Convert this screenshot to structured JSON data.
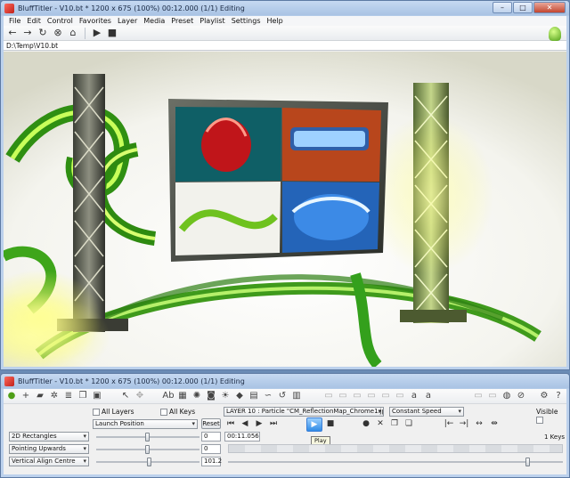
{
  "main_window": {
    "title": "BluffTitler - V10.bt * 1200 x 675 (100%) 00:12.000 (1/1) Editing",
    "menu": [
      "File",
      "Edit",
      "Control",
      "Favorites",
      "Layer",
      "Media",
      "Preset",
      "Playlist",
      "Settings",
      "Help"
    ],
    "path": "D:\\Temp\\V10.bt",
    "caption_buttons": {
      "minimize": "–",
      "maximize": "□",
      "close": "✕"
    }
  },
  "control_window": {
    "title": "BluffTitler - V10.bt * 1200 x 675 (100%) 00:12.000 (1/1) Editing",
    "all_layers_label": "All Layers",
    "all_keys_label": "All Keys",
    "launch_position": "Launch Position",
    "reset_label": "Reset",
    "layer_select": "LAYER 10      : Particle \"CM_ReflectionMap_Chrome1.jpg\"",
    "speed_select": "Constant Speed",
    "visible_label": "Visible",
    "dropdown_1": "2D Rectangles",
    "dropdown_2": "Pointing Upwards",
    "dropdown_3": "Vertical Align Centre",
    "value_1": "0",
    "value_2": "0",
    "value_3": "101.2",
    "time_value": "00:11.056",
    "play_tooltip": "Play",
    "keys_count": "1 Keys"
  },
  "colors": {
    "accent": "#2f8be6",
    "titlebar": "#bcd1ec",
    "panel": "#f0f0f0"
  }
}
